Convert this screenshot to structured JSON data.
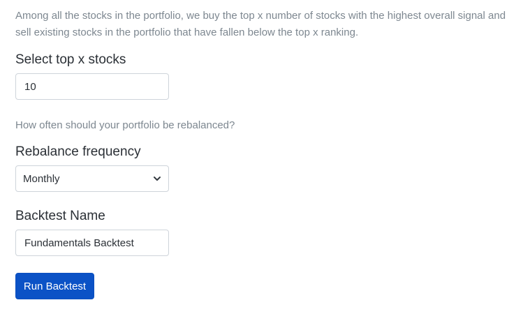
{
  "strategy": {
    "description": "Among all the stocks in the portfolio, we buy the top x number of stocks with the highest overall signal and sell existing stocks in the portfolio that have fallen below the top x ranking.",
    "top_x_label": "Select top x stocks",
    "top_x_value": "10"
  },
  "rebalance": {
    "help": "How often should your portfolio be rebalanced?",
    "label": "Rebalance frequency",
    "selected": "Monthly",
    "icon": "chevron-down-icon"
  },
  "backtest": {
    "name_label": "Backtest Name",
    "name_value": "Fundamentals Backtest",
    "run_label": "Run Backtest"
  },
  "colors": {
    "primary": "#0b52c6",
    "help_text": "#7d8790",
    "border": "#ced4da"
  }
}
